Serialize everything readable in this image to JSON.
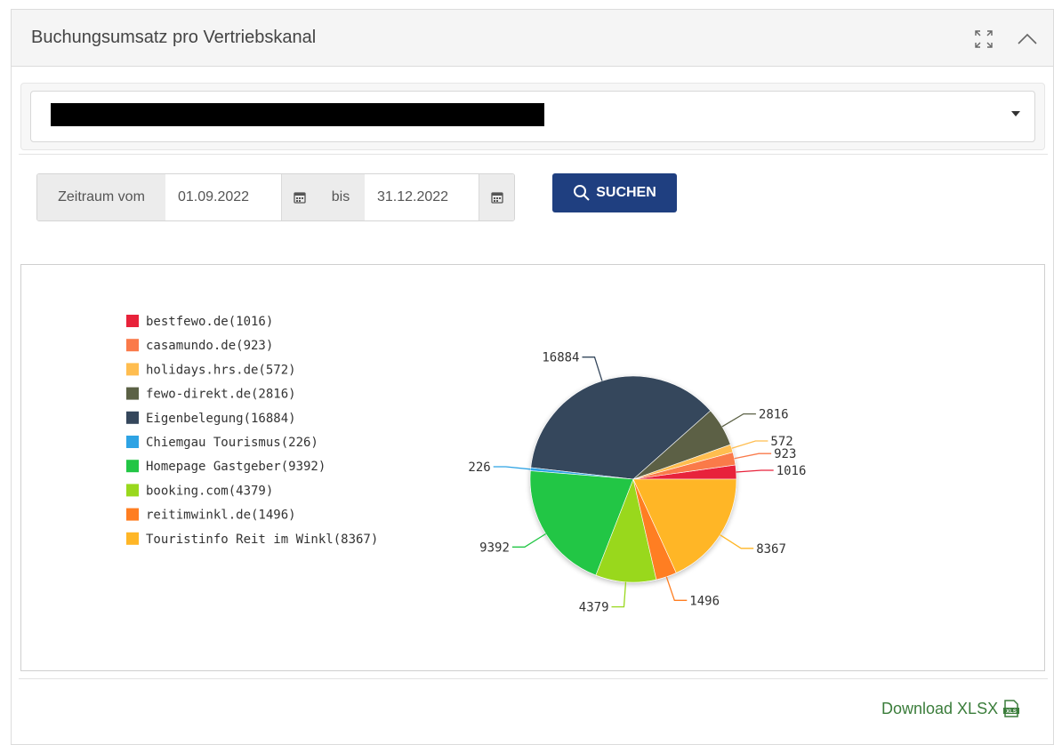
{
  "panel": {
    "title": "Buchungsumsatz pro Vertriebskanal",
    "expand_icon": "expand-icon",
    "collapse_icon": "chevron-up-icon"
  },
  "filter": {
    "select_caret_icon": "caret-down-icon",
    "date_from_label": "Zeitraum vom",
    "date_from_value": "01.09.2022",
    "date_to_label": "bis",
    "date_to_value": "31.12.2022",
    "calendar_icon": "calendar-icon",
    "search_label": "SUCHEN",
    "search_icon": "search-icon",
    "search_color": "#1f3f80"
  },
  "download": {
    "label": "Download XLSX",
    "icon": "xlsx-file-icon"
  },
  "chart_data": {
    "type": "pie",
    "legend_position": "left",
    "categories": [
      "bestfewo.de(1016)",
      "casamundo.de(923)",
      "holidays.hrs.de(572)",
      "fewo-direkt.de(2816)",
      "Eigenbelegung(16884)",
      "Chiemgau Tourismus(226)",
      "Homepage Gastgeber(9392)",
      "booking.com(4379)",
      "reitimwinkl.de(1496)",
      "Touristinfo Reit im Winkl(8367)"
    ],
    "values": [
      1016,
      923,
      572,
      2816,
      16884,
      226,
      9392,
      4379,
      1496,
      8367
    ],
    "value_labels": [
      "1016",
      "923",
      "572",
      "2816",
      "16884",
      "226",
      "9392",
      "4379",
      "1496",
      "8367"
    ],
    "colors": [
      "#e8223a",
      "#fa7a4a",
      "#ffbd4f",
      "#5b6145",
      "#35475c",
      "#2ea3e4",
      "#22c645",
      "#99d81d",
      "#ff7e21",
      "#ffb626"
    ]
  }
}
